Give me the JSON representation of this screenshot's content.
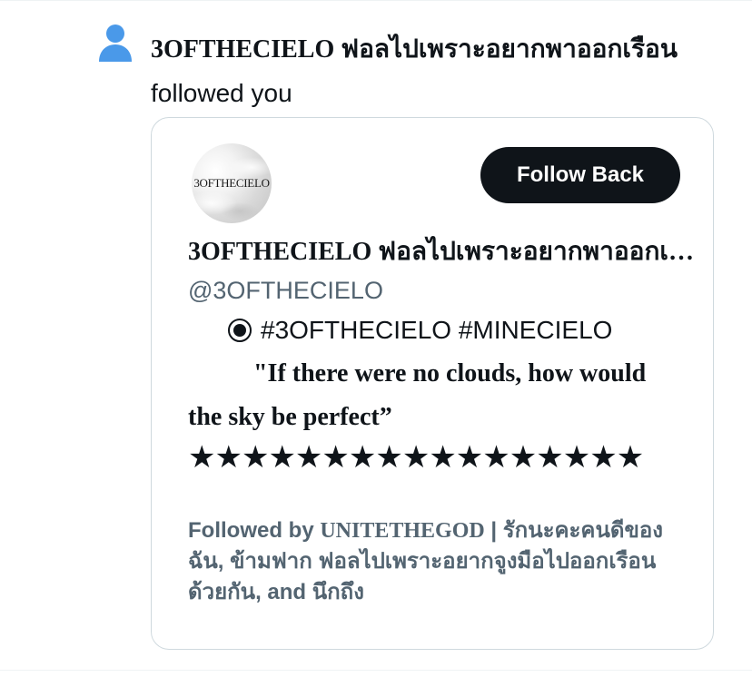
{
  "notification": {
    "icon": "person-icon",
    "actor_name": "3OFTHECIELO ฟอลไปเพราะอยากพาออกเรือน",
    "action_text": " followed you"
  },
  "profile_card": {
    "avatar_text": "3OFTHECIELO",
    "follow_back_label": "Follow Back",
    "display_name": "3OFTHECIELO ฟอลไปเพราะอยากพาออกเรือน",
    "handle": "@3OFTHECIELO",
    "bio": {
      "tags": "#3OFTHECIELO #MINECIELO",
      "quote": "\"If there were no clouds, how would the sky be perfect”",
      "stars": "★★★★★★★★★★★★★★★★★"
    },
    "followed_by": {
      "prefix": "Followed by ",
      "first_name": "UNITETHEGOD",
      "rest": " | รักนะคะคนดีของฉัน, ข้ามฟาก ฟอลไปเพราะอยากจูงมือไปออกเรือนด้วยกัน, and นึกถึง"
    }
  },
  "colors": {
    "primary_text": "#0f1419",
    "secondary_text": "#536471",
    "button_bg": "#0f1419",
    "border": "#cfd9de",
    "icon_blue": "#4a99e9"
  }
}
